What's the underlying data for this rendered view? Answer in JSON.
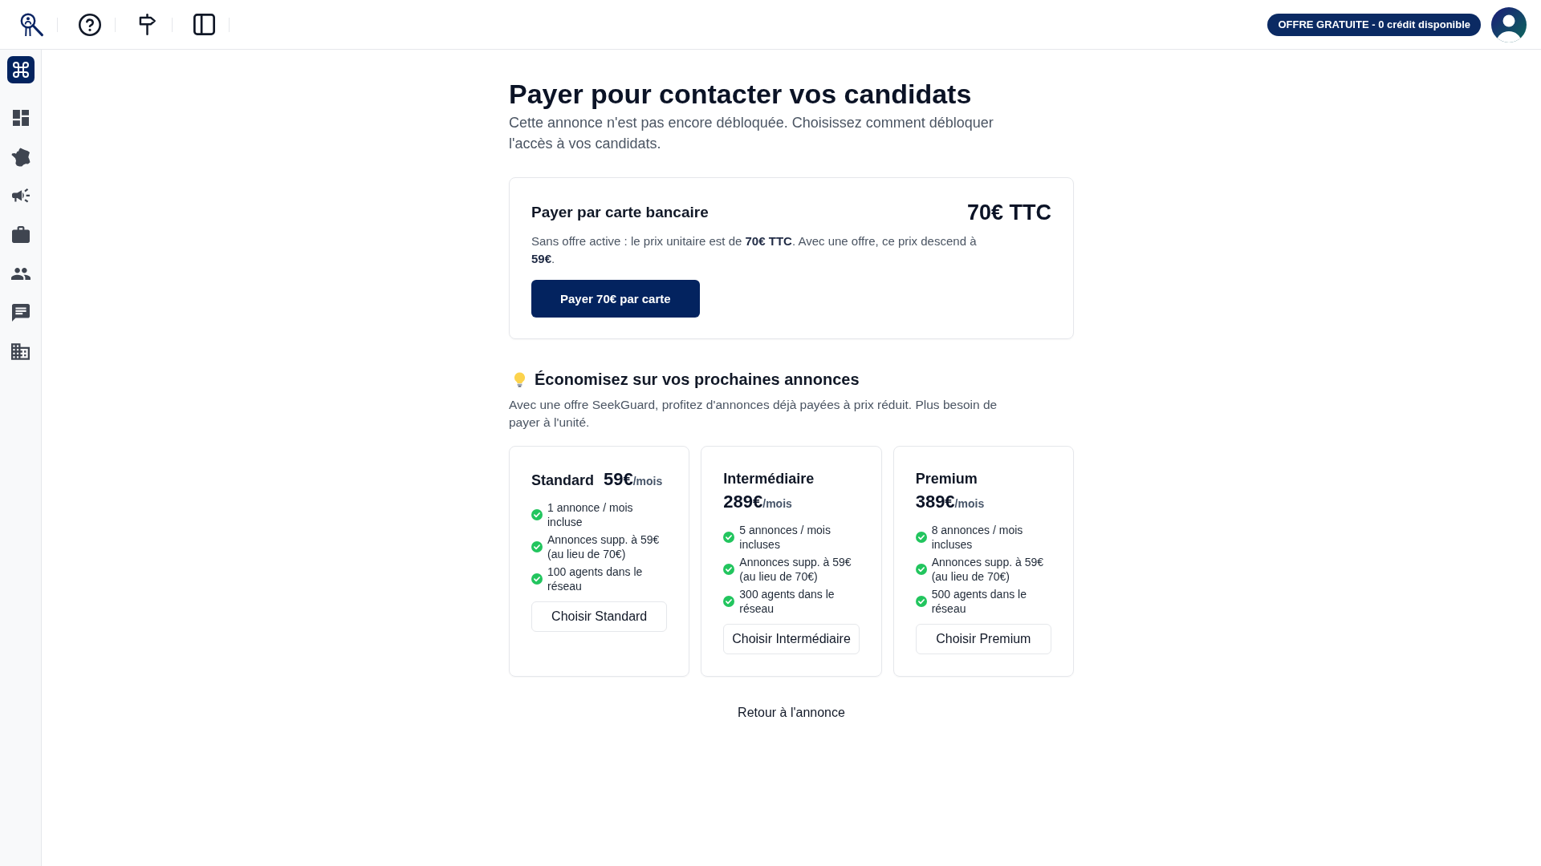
{
  "top_bar": {
    "plan_badge": "OFFRE GRATUITE - 0 crédit disponible"
  },
  "header": {
    "title": "Payer pour contacter vos candidats",
    "subtitle": "Cette annonce n'est pas encore débloquée. Choisissez comment débloquer l'accès à vos candidats."
  },
  "card_payment": {
    "title": "Payer par carte bancaire",
    "price": "70€ TTC",
    "description": "Sans offre active : le prix unitaire est de **70€ TTC**. Avec une offre, ce prix descend à **59€**.",
    "button": "Payer 70€ par carte"
  },
  "offers": {
    "title": "Économisez sur vos prochaines annonces",
    "description": "Avec une offre SeekGuard, profitez d'annonces déjà payées à prix réduit. Plus besoin de payer à l'unité.",
    "plans": [
      {
        "name": "Standard",
        "price": "59€",
        "period": "/mois",
        "features": [
          "1 annonce / mois incluse",
          "Annonces supp. à 59€ (au lieu de 70€)",
          "100 agents dans le réseau"
        ],
        "button": "Choisir Standard"
      },
      {
        "name": "Intermédiaire",
        "price": "289€",
        "period": "/mois",
        "features": [
          "5 annonces / mois incluses",
          "Annonces supp. à 59€ (au lieu de 70€)",
          "300 agents dans le réseau"
        ],
        "button": "Choisir Intermédiaire"
      },
      {
        "name": "Premium",
        "price": "389€",
        "period": "/mois",
        "features": [
          "8 annonces / mois incluses",
          "Annonces supp. à 59€ (au lieu de 70€)",
          "500 agents dans le réseau"
        ],
        "button": "Choisir Premium"
      }
    ]
  },
  "back_link": "Retour à l'annonce"
}
